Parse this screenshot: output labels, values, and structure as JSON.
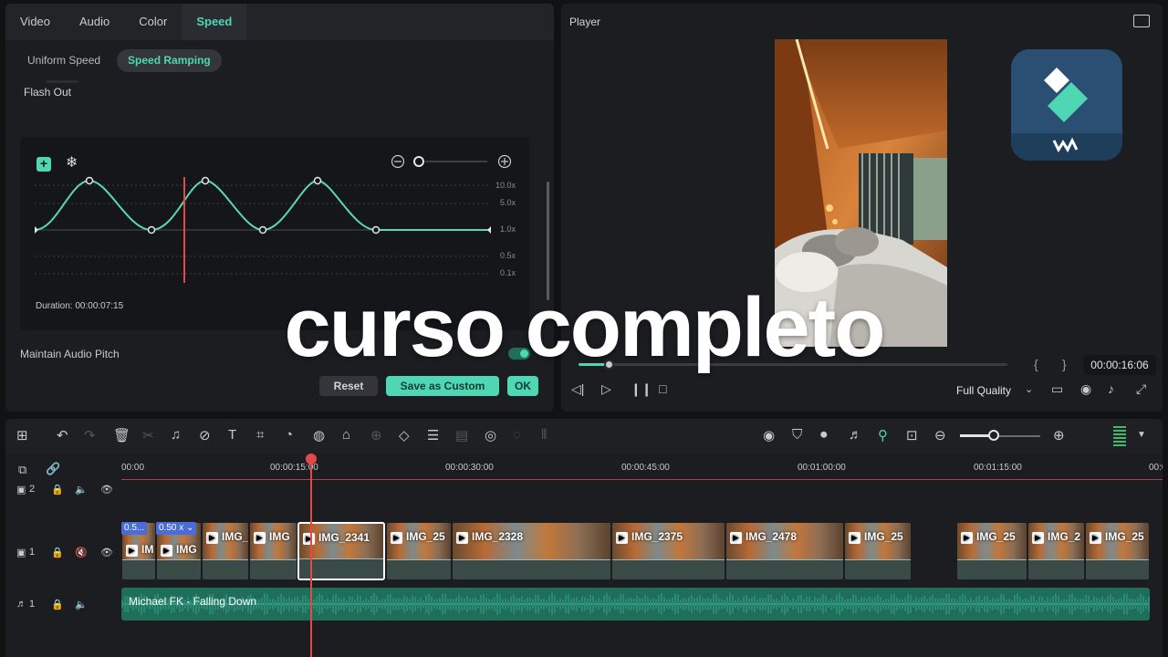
{
  "editor": {
    "tabs": [
      {
        "label": "Video"
      },
      {
        "label": "Audio"
      },
      {
        "label": "Color"
      },
      {
        "label": "Speed"
      }
    ],
    "active_tab": "Speed",
    "subtabs": [
      {
        "label": "Uniform Speed"
      },
      {
        "label": "Speed Ramping"
      }
    ],
    "preset_label": "Flash Out",
    "graph": {
      "duration_label": "Duration: 00:00:07:15",
      "speed_levels": [
        "10.0x",
        "5.0x",
        "1.0x",
        "0.5x",
        "0.1x"
      ]
    },
    "maintain_pitch_label": "Maintain Audio Pitch",
    "maintain_pitch_on": true,
    "buttons": {
      "reset": "Reset",
      "save_custom": "Save as Custom",
      "ok": "OK"
    }
  },
  "player": {
    "title": "Player",
    "timecode": "00:00:16:06",
    "progress_fraction": 0.07,
    "quality": "Full Quality",
    "brace_open": "{",
    "brace_close": "}"
  },
  "timeline": {
    "ruler_labels": [
      "00:00",
      "00:00:15:00",
      "00:00:30:00",
      "00:00:45:00",
      "00:01:00:00",
      "00:01:15:00",
      "00:0"
    ],
    "tracks": [
      {
        "label": "2",
        "kind": "video"
      },
      {
        "label": "1",
        "kind": "video"
      },
      {
        "label": "1",
        "kind": "audio"
      }
    ],
    "speed_tags": [
      "0.5...",
      "0.50 x ⌄"
    ],
    "clips": [
      {
        "name": "IM"
      },
      {
        "name": "IMG"
      },
      {
        "name": "IMG_"
      },
      {
        "name": "IMG"
      },
      {
        "name": "IMG_2341"
      },
      {
        "name": "IMG_25"
      },
      {
        "name": "IMG_2328"
      },
      {
        "name": "IMG_2375"
      },
      {
        "name": "IMG_2478"
      },
      {
        "name": "IMG_25"
      },
      {
        "name": "IMG_25"
      },
      {
        "name": "IMG_2"
      },
      {
        "name": "IMG_25"
      }
    ],
    "audio_clip": "Michael FK - Falling Down"
  },
  "overlay_title": "curso completo",
  "colors": {
    "accent": "#4fd6b3",
    "playhead": "#e24a4a",
    "background": "#1c1d21"
  }
}
